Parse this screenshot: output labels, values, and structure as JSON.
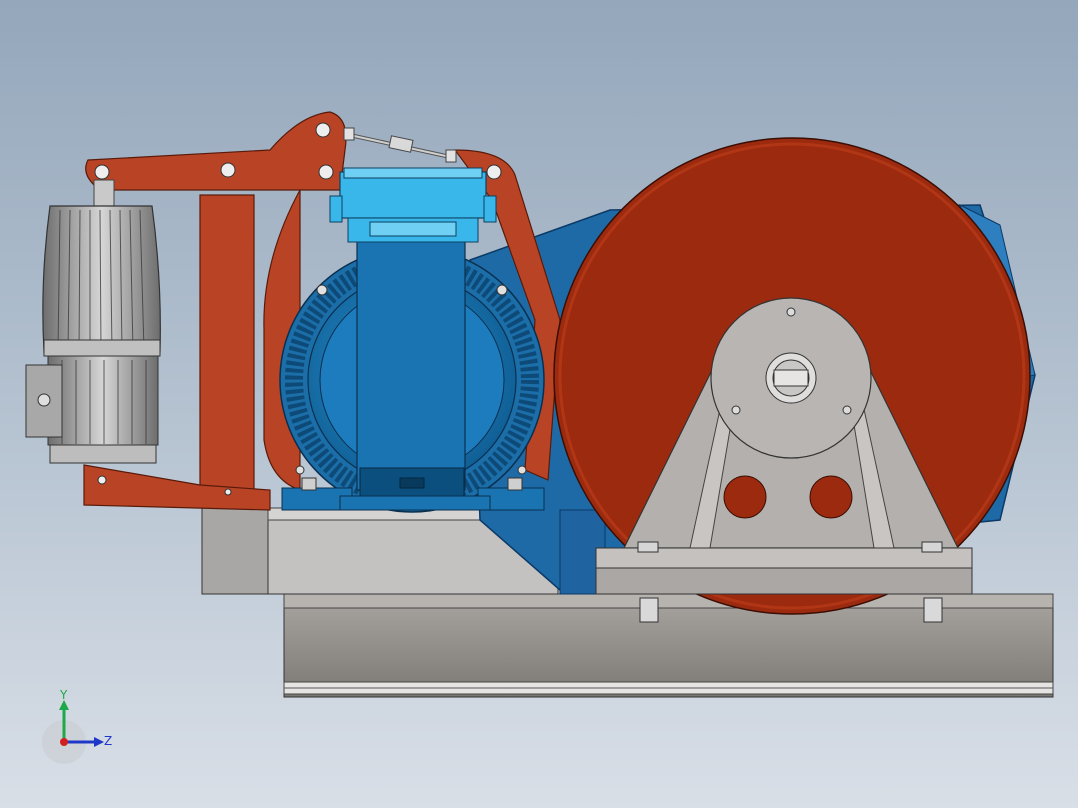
{
  "viewport": {
    "background_top": "#94a7bb",
    "background_bottom": "#d9dfe7"
  },
  "colors": {
    "brake_red": "#b84425",
    "drum_red": "#9c2a0f",
    "motor_blue": "#1b78b4",
    "junction_cyan": "#3ab7ea",
    "frame_gray": "#b3b0ad",
    "base_gray": "#8a8682",
    "thruster_gray": "#9c9c9c"
  },
  "model": {
    "components": [
      {
        "name": "hydraulic-thruster-icon"
      },
      {
        "name": "brake-lever-arm-icon"
      },
      {
        "name": "tie-rod-icon"
      },
      {
        "name": "electric-motor-icon"
      },
      {
        "name": "terminal-box-icon"
      },
      {
        "name": "brake-drum-icon"
      },
      {
        "name": "bearing-pedestal-icon"
      },
      {
        "name": "base-frame-icon"
      }
    ]
  },
  "triad": {
    "y_label": "Y",
    "z_label": "Z",
    "y_color": "#1fa84a",
    "z_color": "#2036c8",
    "x_color": "#d21f1f"
  }
}
